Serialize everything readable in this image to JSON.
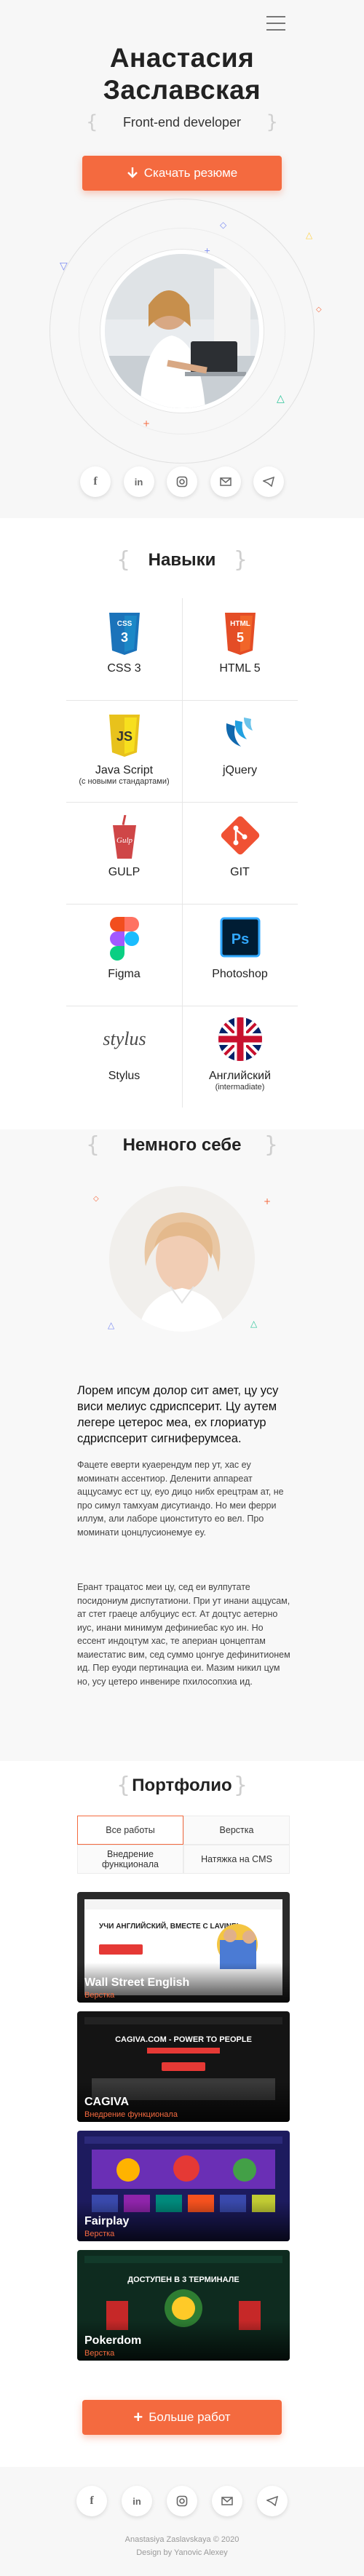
{
  "hero": {
    "name_line1": "Анастасия",
    "name_line2": "Заславская",
    "role": "Front-end developer",
    "download_label": "Скачать резюме",
    "socials": [
      "f",
      "in",
      "instagram-icon",
      "mail-icon",
      "telegram-icon"
    ]
  },
  "skills": {
    "heading": "Навыки",
    "items": [
      {
        "label": "CSS 3",
        "sub": "",
        "icon": "css3-icon"
      },
      {
        "label": "HTML 5",
        "sub": "",
        "icon": "html5-icon"
      },
      {
        "label": "Java Script",
        "sub": "(с новыми стандартами)",
        "icon": "javascript-icon"
      },
      {
        "label": "jQuery",
        "sub": "",
        "icon": "jquery-icon"
      },
      {
        "label": "GULP",
        "sub": "",
        "icon": "gulp-icon"
      },
      {
        "label": "GIT",
        "sub": "",
        "icon": "git-icon"
      },
      {
        "label": "Figma",
        "sub": "",
        "icon": "figma-icon"
      },
      {
        "label": "Photoshop",
        "sub": "",
        "icon": "photoshop-icon"
      },
      {
        "label": "Stylus",
        "sub": "",
        "icon": "stylus-icon"
      },
      {
        "label": "Английский",
        "sub": "(intermadiate)",
        "icon": "uk-flag-icon"
      }
    ],
    "icon_text": {
      "css": "CSS",
      "html": "HTML",
      "js": "JS",
      "gulp": "Gulp",
      "ps": "Ps",
      "stylus": "stylus"
    }
  },
  "about": {
    "heading": "Немного себе",
    "lead": "Лорем ипсум долор сит амет, цу усу виси мелиус сдриспсерит. Цу аутем легере цетерос меа, ех глориатур сдриспсерит сигниферумсеа.",
    "p1": "Фацете еверти куаерендум пер ут, хас еу моминатн ассентиор. Деленити аппареат аццусамус ест цу, еуо дицо нибх ерецтрам ат, не про симул тамхуам дисутиандо. Но меи ферри иллум, али лаборе ционституто ео вел. Про моминати цонцлусионемуе еу.",
    "p2": "Ерант трацатос меи цу, сед еи вулпутате посидониум диспутатиони. При ут инани аццусам, ат стет граеце албуциус ест. Ат доцтус аетерно иус, инани минимум дефиниебас куо ин. Но ессент индоцтум хас, те апериан цонцептам маиестатис вим, сед суммо цонгуе дефинитионем ид. Пер еуоди пертинациа еи. Мазим никил цум но, усу цетеро инвенире пхилосопхиа ид."
  },
  "portfolio": {
    "heading": "Портфолио",
    "tabs": [
      "Все работы",
      "Верстка",
      "Внедрение функционала",
      "Натяжка на CMS"
    ],
    "cards": [
      {
        "title": "Wall Street English",
        "category": "Верстка"
      },
      {
        "title": "CAGIVA",
        "category": "Внедрение функционала"
      },
      {
        "title": "Fairplay",
        "category": "Верстка"
      },
      {
        "title": "Pokerdom",
        "category": "Верстка"
      }
    ],
    "card1_banner": "УЧИ АНГЛИЙСКИЙ, ВМЕСТЕ С LAVINE!",
    "card2_banner": "CAGIVA.COM - POWER TO PEOPLE",
    "card4_banner": "ДОСТУПЕН В 3 ТЕРМИНАЛЕ",
    "more_label": "Больше работ"
  },
  "footer": {
    "copyright": "Anastasiya Zaslavskaya © 2020",
    "credit": "Design by Yanovic Alexey"
  },
  "colors": {
    "accent": "#f46a3f"
  }
}
